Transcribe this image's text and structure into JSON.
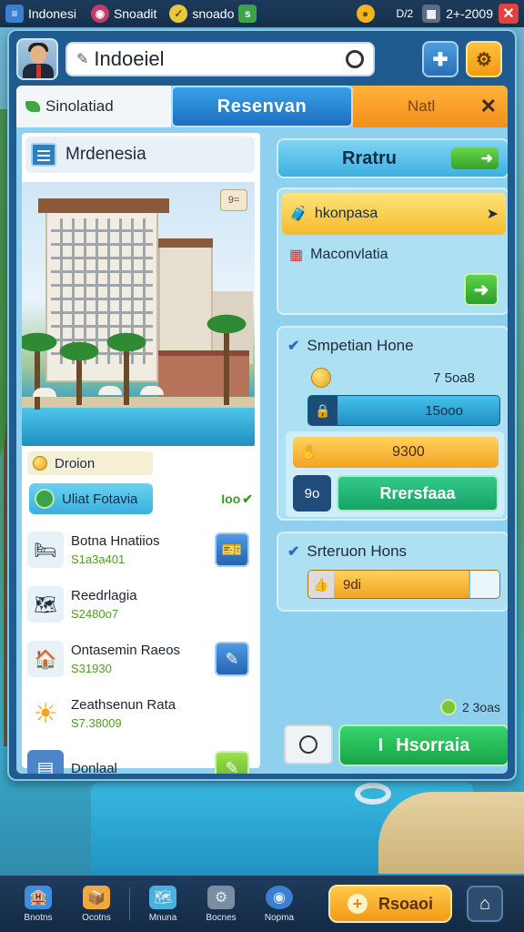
{
  "topbar": {
    "location_label": "Indonesi",
    "currency1_value": "Snoadit",
    "currency2_value": "snoado",
    "currency2_badge": "s",
    "coin_label": "D/2",
    "date_value": "2+-2009",
    "icons": [
      "menu-icon",
      "globe-icon",
      "coin-icon",
      "gold-coin-icon",
      "calendar-icon",
      "close-icon"
    ]
  },
  "header": {
    "search_value": "Indoeiel",
    "avatar": "player-avatar"
  },
  "tabs": {
    "left_label": "Sinolatiad",
    "active_label": "Resenvan",
    "right_label": "Natl",
    "close_glyph": "✕"
  },
  "hotel": {
    "title": "Mrdenesia",
    "badge_text": "9="
  },
  "options": {
    "label": "Droion"
  },
  "filter": {
    "label": "Uliat Fotavia",
    "count": "Ioo"
  },
  "list": [
    {
      "name": "Botna Hnatiios",
      "price": "S1a3a401"
    },
    {
      "name": "Reedrlagia",
      "price": "S2480o7"
    },
    {
      "name": "Ontasemin Raeos",
      "price": "S31930"
    },
    {
      "name": "Zeathsenun Rata",
      "price": "S7.38009"
    },
    {
      "name": "Donlaal",
      "price": ""
    }
  ],
  "right": {
    "top_button": "Rratru",
    "card1_row1": "hkonpasa",
    "card1_row2": "Maconvlatia",
    "section1_title": "Smpetian Hone",
    "section1_coin_value": "7 5oa8",
    "section1_bar_value": "15ooo",
    "section1_orange_value": "9300",
    "section1_small_label": "9o",
    "section1_button": "Rrersfaaa",
    "section2_title": "Srteruon Hons",
    "section2_slider_value": "9di",
    "balance": "2 3oas",
    "book_button": "Hsorraia",
    "book_prefix": "I"
  },
  "nav": {
    "items": [
      "Bnotns",
      "Ocotns",
      "Mnuna",
      "Bocnes",
      "Nopma"
    ],
    "cta_label": "Rsoaoi"
  }
}
